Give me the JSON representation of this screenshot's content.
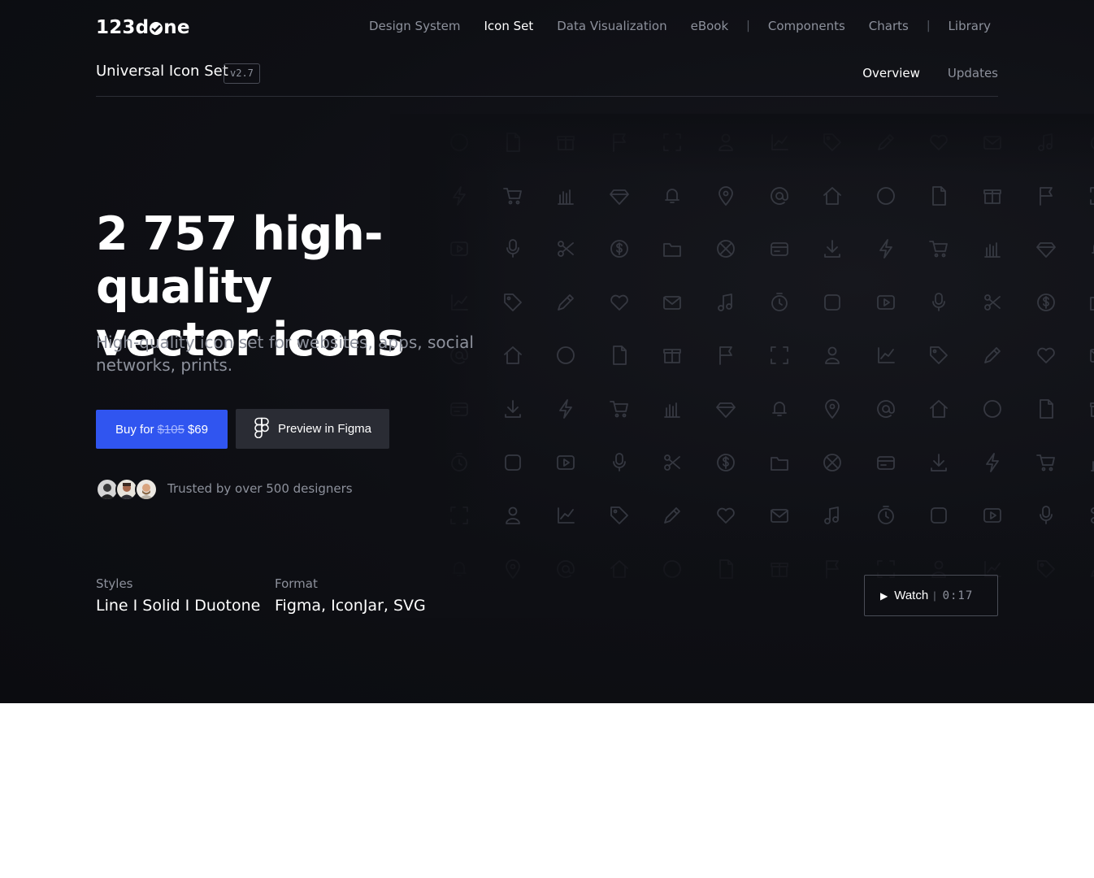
{
  "brand": {
    "logo_part1": "123d",
    "logo_part2": "ne"
  },
  "topnav": {
    "items": [
      "Design System",
      "Icon Set",
      "Data Visualization",
      "eBook",
      "Components",
      "Charts",
      "Library"
    ],
    "separator": "|"
  },
  "subheader": {
    "title": "Universal Icon Set",
    "version": "v2.7",
    "tabs": [
      "Overview",
      "Updates"
    ]
  },
  "hero": {
    "headline_line1": "2 757 high-quality",
    "headline_line2": "vector icons",
    "subtitle": "High-quality icon set for websites, apps, social networks, prints."
  },
  "actions": {
    "buy_prefix": "Buy for",
    "buy_old_price": "$105",
    "buy_price": "$69",
    "figma_label": "Preview in Figma"
  },
  "social_proof": {
    "text": "Trusted by over 500 designers"
  },
  "meta": {
    "styles_label": "Styles",
    "styles_value": "Line I Solid I Duotone",
    "format_label": "Format",
    "format_value": "Figma, IconJar, SVG"
  },
  "watch": {
    "label": "Watch",
    "separator": "|",
    "duration": "0:17"
  },
  "colors": {
    "accent": "#3055f0",
    "background": "#0e0f14",
    "muted_text": "#8d919c",
    "icon_stroke": "#3a3d46"
  }
}
